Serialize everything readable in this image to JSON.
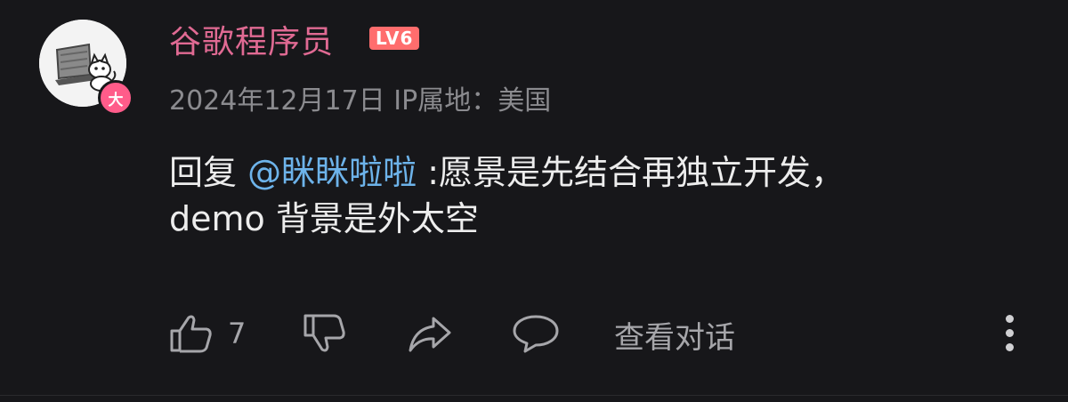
{
  "comment": {
    "avatar_badge": "大",
    "username": "谷歌程序员",
    "level": "LV6",
    "date": "2024年12月17日",
    "ip_label": "IP属地：",
    "ip_location": "美国",
    "reply_prefix": "回复",
    "mention": "@眯眯啦啦",
    "text_line1": " :愿景是先结合再独立开发，",
    "text_line2": "demo 背景是外太空"
  },
  "actions": {
    "like_count": "7",
    "view_conversation": "查看对话"
  },
  "colors": {
    "background": "#17171a",
    "username": "#e06a93",
    "mention": "#6db3ea",
    "level_badge": "#ff6d6d"
  },
  "icons": [
    "thumbs-up-icon",
    "thumbs-down-icon",
    "share-icon",
    "comment-icon",
    "more-vertical-icon"
  ]
}
